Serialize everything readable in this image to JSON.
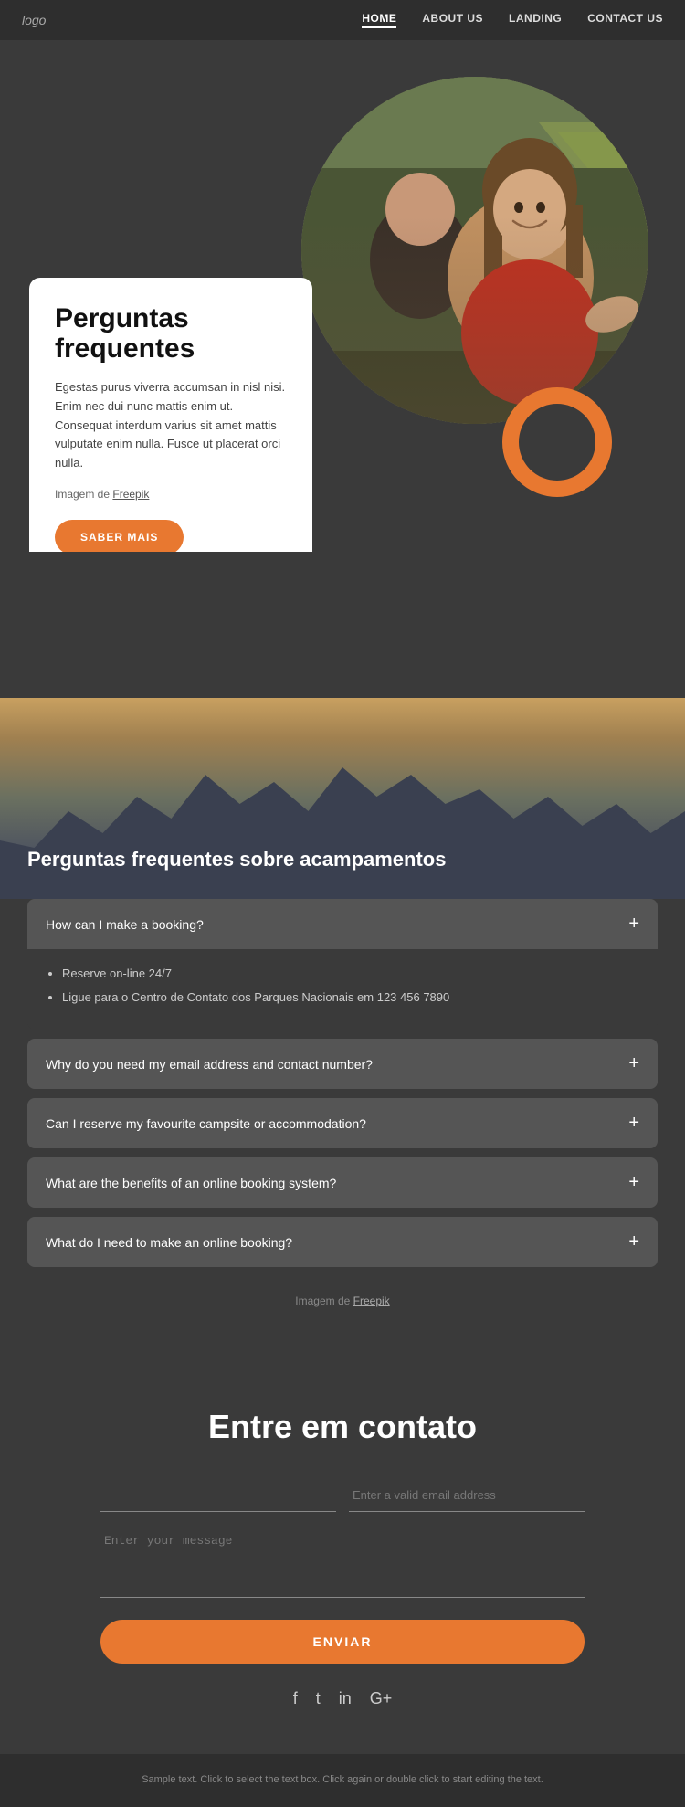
{
  "nav": {
    "logo": "logo",
    "links": [
      {
        "label": "HOME",
        "id": "home",
        "active": true
      },
      {
        "label": "ABOUT US",
        "id": "about",
        "active": false
      },
      {
        "label": "LANDING",
        "id": "landing",
        "active": false
      },
      {
        "label": "CONTACT US",
        "id": "contact",
        "active": false
      }
    ]
  },
  "hero": {
    "title": "Perguntas frequentes",
    "body": "Egestas purus viverra accumsan in nisl nisi. Enim nec dui nunc mattis enim ut. Consequat interdum varius sit amet mattis vulputate enim nulla. Fusce ut placerat orci nulla.",
    "image_credit_prefix": "Imagem de ",
    "image_credit_link": "Freepik",
    "cta_label": "SABER MAIS"
  },
  "mountains": {
    "title": "Perguntas frequentes sobre acampamentos"
  },
  "faq": {
    "items": [
      {
        "id": "faq1",
        "question": "How can I make a booking?",
        "open": true,
        "answer_items": [
          "Reserve on-line 24/7",
          "Ligue para o Centro de Contato dos Parques Nacionais em 123 456 7890"
        ]
      },
      {
        "id": "faq2",
        "question": "Why do you need my email address and contact number?",
        "open": false,
        "answer_items": []
      },
      {
        "id": "faq3",
        "question": "Can I reserve my favourite campsite or accommodation?",
        "open": false,
        "answer_items": []
      },
      {
        "id": "faq4",
        "question": "What are the benefits of an online booking system?",
        "open": false,
        "answer_items": []
      },
      {
        "id": "faq5",
        "question": "What do I need to make an online booking?",
        "open": false,
        "answer_items": []
      }
    ],
    "image_credit_prefix": "Imagem de ",
    "image_credit_link": "Freepik"
  },
  "contact": {
    "title": "Entre em contato",
    "name_placeholder": "",
    "email_placeholder": "Enter a valid email address",
    "message_placeholder": "Enter your message",
    "submit_label": "ENVIAR"
  },
  "social": {
    "icons": [
      {
        "name": "facebook",
        "symbol": "f"
      },
      {
        "name": "twitter",
        "symbol": "t"
      },
      {
        "name": "instagram",
        "symbol": "in"
      },
      {
        "name": "google-plus",
        "symbol": "G+"
      }
    ]
  },
  "footer": {
    "text": "Sample text. Click to select the text box. Click again or double\nclick to start editing the text."
  }
}
